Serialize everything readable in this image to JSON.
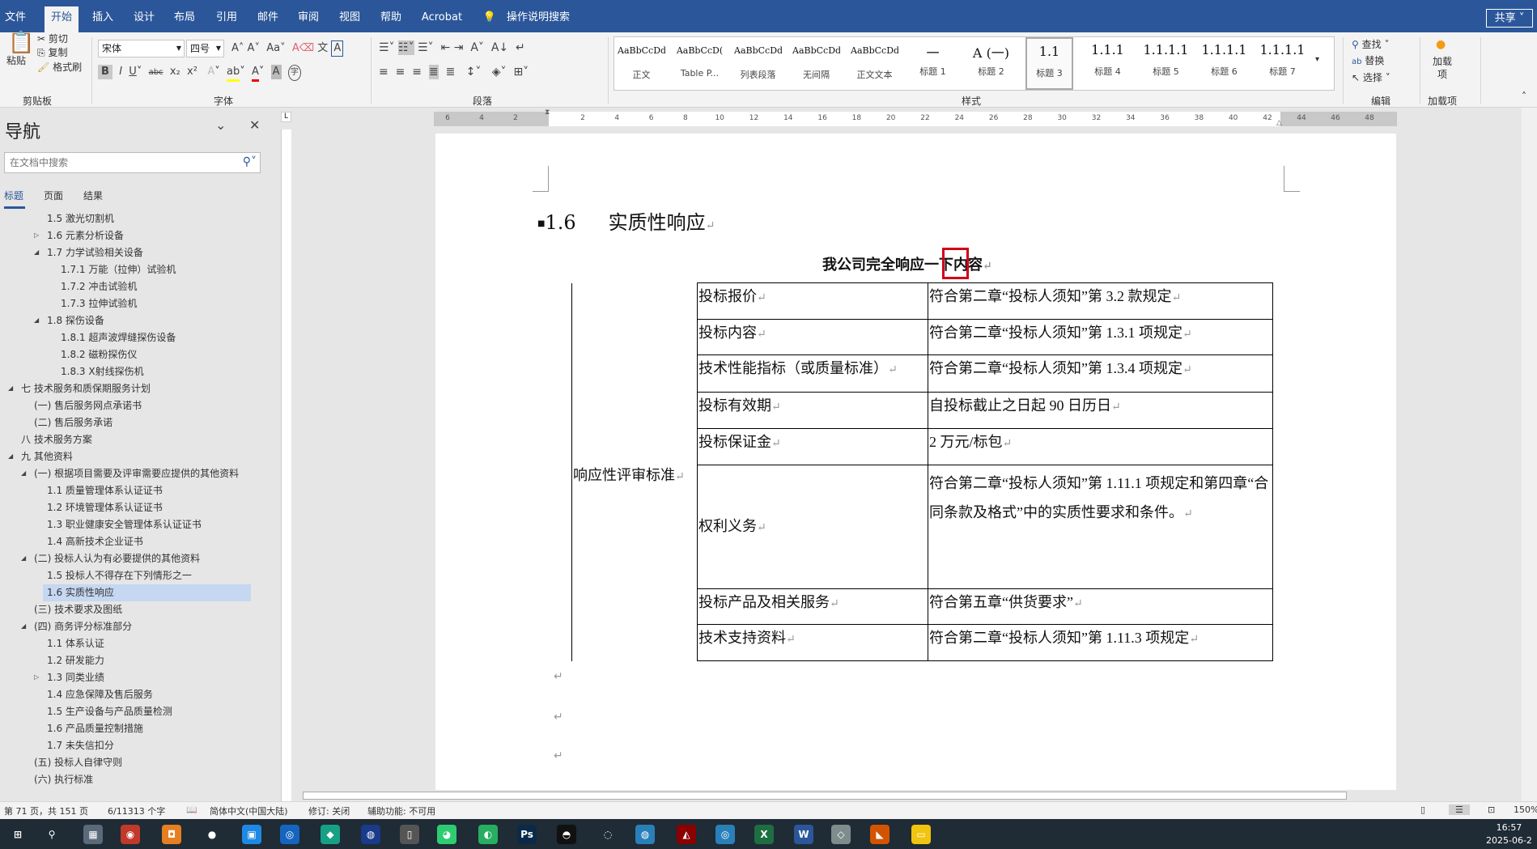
{
  "tabs": [
    "文件",
    "开始",
    "插入",
    "设计",
    "布局",
    "引用",
    "邮件",
    "审阅",
    "视图",
    "帮助",
    "Acrobat"
  ],
  "active_tab": "开始",
  "tell_me": "操作说明搜索",
  "share": "共享",
  "ribbon": {
    "clipboard": {
      "paste": "粘贴",
      "cut": "剪切",
      "copy": "复制",
      "format_painter": "格式刷",
      "label": "剪贴板"
    },
    "font": {
      "name": "宋体",
      "size": "四号",
      "label": "字体"
    },
    "paragraph": {
      "label": "段落"
    },
    "styles": {
      "label": "样式",
      "items": [
        {
          "preview": "AaBbCcDdI",
          "name": "正文"
        },
        {
          "preview": "AaBbCcD(",
          "name": "Table P..."
        },
        {
          "preview": "AaBbCcDdI",
          "name": "列表段落"
        },
        {
          "preview": "AaBbCcDdI",
          "name": "无间隔"
        },
        {
          "preview": "AaBbCcDdI",
          "name": "正文文本"
        },
        {
          "preview": "一",
          "name": "标题 1"
        },
        {
          "preview": "A  (一)",
          "name": "标题 2"
        },
        {
          "preview": "1.1",
          "name": "标题 3"
        },
        {
          "preview": "1.1.1",
          "name": "标题 4"
        },
        {
          "preview": "1.1.1.1",
          "name": "标题 5"
        },
        {
          "preview": "1.1.1.1",
          "name": "标题 6"
        },
        {
          "preview": "1.1.1.1",
          "name": "标题 7"
        }
      ]
    },
    "editing": {
      "find": "查找",
      "replace": "替换",
      "select": "选择",
      "label": "编辑"
    },
    "addins": {
      "button": "加载项",
      "label": "加载项"
    }
  },
  "nav": {
    "title": "导航",
    "search_placeholder": "在文档中搜索",
    "tabs": [
      "标题",
      "页面",
      "结果"
    ],
    "items": [
      {
        "text": "1.5 激光切割机",
        "level": 2,
        "state": "none"
      },
      {
        "text": "1.6 元素分析设备",
        "level": 2,
        "state": "collapsed"
      },
      {
        "text": "1.7 力学试验相关设备",
        "level": 2,
        "state": "expanded"
      },
      {
        "text": "1.7.1 万能（拉伸）试验机",
        "level": 3,
        "state": "none"
      },
      {
        "text": "1.7.2 冲击试验机",
        "level": 3,
        "state": "none"
      },
      {
        "text": "1.7.3 拉伸试验机",
        "level": 3,
        "state": "none"
      },
      {
        "text": "1.8 探伤设备",
        "level": 2,
        "state": "expanded"
      },
      {
        "text": "1.8.1 超声波焊缝探伤设备",
        "level": 3,
        "state": "none"
      },
      {
        "text": "1.8.2 磁粉探伤仪",
        "level": 3,
        "state": "none"
      },
      {
        "text": "1.8.3 X射线探伤机",
        "level": 3,
        "state": "none"
      },
      {
        "text": "七 技术服务和质保期服务计划",
        "level": 0,
        "state": "expanded"
      },
      {
        "text": "(一) 售后服务网点承诺书",
        "level": 1,
        "state": "none"
      },
      {
        "text": "(二) 售后服务承诺",
        "level": 1,
        "state": "none"
      },
      {
        "text": "八 技术服务方案",
        "level": 0,
        "state": "none"
      },
      {
        "text": "九 其他资料",
        "level": 0,
        "state": "expanded"
      },
      {
        "text": "(一) 根据项目需要及评审需要应提供的其他资料",
        "level": 1,
        "state": "expanded"
      },
      {
        "text": "1.1 质量管理体系认证证书",
        "level": 2,
        "state": "none"
      },
      {
        "text": "1.2 环境管理体系认证证书",
        "level": 2,
        "state": "none"
      },
      {
        "text": "1.3 职业健康安全管理体系认证证书",
        "level": 2,
        "state": "none"
      },
      {
        "text": "1.4 高新技术企业证书",
        "level": 2,
        "state": "none"
      },
      {
        "text": "(二) 投标人认为有必要提供的其他资料",
        "level": 1,
        "state": "expanded"
      },
      {
        "text": "1.5 投标人不得存在下列情形之一",
        "level": 2,
        "state": "none"
      },
      {
        "text": "1.6 实质性响应",
        "level": 2,
        "state": "selected"
      },
      {
        "text": "(三) 技术要求及图纸",
        "level": 1,
        "state": "none"
      },
      {
        "text": "(四) 商务评分标准部分",
        "level": 1,
        "state": "expanded"
      },
      {
        "text": "1.1 体系认证",
        "level": 2,
        "state": "none"
      },
      {
        "text": "1.2 研发能力",
        "level": 2,
        "state": "none"
      },
      {
        "text": "1.3 同类业绩",
        "level": 2,
        "state": "collapsed"
      },
      {
        "text": "1.4 应急保障及售后服务",
        "level": 2,
        "state": "none"
      },
      {
        "text": "1.5 生产设备与产品质量检测",
        "level": 2,
        "state": "none"
      },
      {
        "text": "1.6 产品质量控制措施",
        "level": 2,
        "state": "none"
      },
      {
        "text": "1.7 未失信扣分",
        "level": 2,
        "state": "none"
      },
      {
        "text": "(五) 投标人自律守则",
        "level": 1,
        "state": "none"
      },
      {
        "text": "(六) 执行标准",
        "level": 1,
        "state": "none"
      }
    ]
  },
  "ruler": {
    "left": [
      "6",
      "4",
      "2"
    ],
    "right": [
      "2",
      "4",
      "6",
      "8",
      "10",
      "12",
      "14",
      "16",
      "18",
      "20",
      "22",
      "24",
      "26",
      "28",
      "30",
      "32",
      "34",
      "36",
      "38",
      "40",
      "42"
    ],
    "margin_right": [
      "44",
      "46",
      "48"
    ]
  },
  "doc": {
    "heading_num": "1.6",
    "heading": "实质性响应",
    "subtitle": "我公司完全响应一下内容",
    "row_header": "响应性评审标准",
    "rows": [
      {
        "item": "投标报价",
        "req": "符合第二章“投标人须知”第 3.2 款规定"
      },
      {
        "item": "投标内容",
        "req": "符合第二章“投标人须知”第 1.3.1 项规定"
      },
      {
        "item": "技术性能指标（或质量标准）",
        "req": "符合第二章“投标人须知”第 1.3.4 项规定"
      },
      {
        "item": "投标有效期",
        "req": "自投标截止之日起 90 日历日"
      },
      {
        "item": "投标保证金",
        "req": "2 万元/标包"
      },
      {
        "item": "权利义务",
        "req": "符合第二章“投标人须知”第 1.11.1 项规定和第四章“合同条款及格式”中的实质性要求和条件。"
      },
      {
        "item": "投标产品及相关服务",
        "req": "符合第五章“供货要求”"
      },
      {
        "item": "技术支持资料",
        "req": "符合第二章“投标人须知”第 1.11.3 项规定"
      }
    ],
    "para_mark": "↵"
  },
  "status": {
    "page": "第 71 页，共 151 页",
    "words": "6/11313 个字",
    "language": "简体中文(中国大陆)",
    "track": "修订: 关闭",
    "accessibility": "辅助功能: 不可用",
    "zoom": "150%"
  },
  "taskbar": {
    "time": "16:57",
    "date": "2025-06-2"
  },
  "colors": {
    "brand": "#2b579a",
    "selection": "#c5d7f1",
    "highlight_box": "#d0021b"
  }
}
